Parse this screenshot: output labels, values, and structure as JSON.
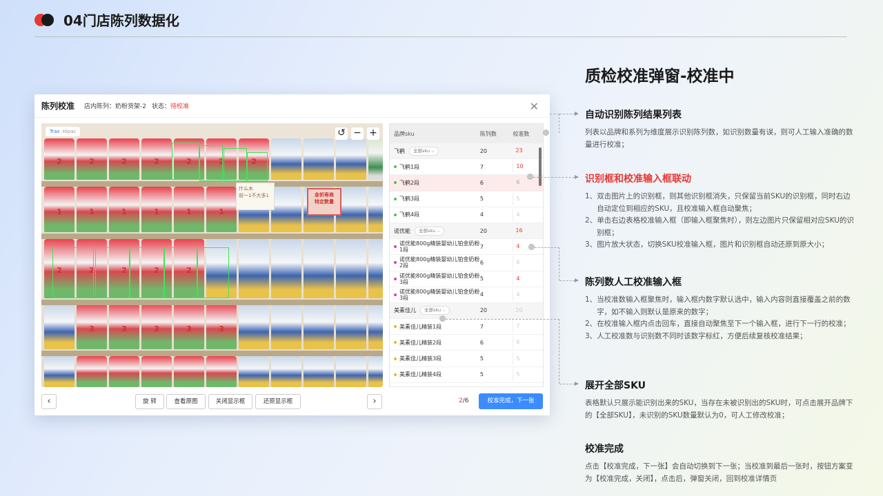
{
  "header": {
    "title": "04门店陈列数据化"
  },
  "dialog": {
    "title": "陈列校准",
    "shelf_label": "店内陈列：",
    "shelf_value": "奶粉货架-2",
    "status_label": "状态：",
    "status_value": "待校准",
    "close": "✕",
    "photo_tabs": [
      "Trax",
      "Hipac"
    ],
    "tools": {
      "rotate": "↺",
      "zoom_out": "−",
      "zoom_in": "+"
    },
    "photo_notes": {
      "card": "什么木\n前一1不大多1",
      "sign": "金祈寿商\n特定数量"
    },
    "table": {
      "headers": [
        "品牌sku",
        "陈列数",
        "校准数"
      ],
      "all_sku": "全部sku ⌵",
      "rows": [
        {
          "type": "brand",
          "sku": "飞鹤",
          "count": "20",
          "cal": "23",
          "style": "red"
        },
        {
          "type": "sku",
          "sku": "飞鹤1段",
          "count": "7",
          "cal": "10",
          "style": "red",
          "dot": "#3cc85a"
        },
        {
          "type": "sku",
          "sku": "飞鹤2段",
          "count": "6",
          "cal": "6",
          "style": "focus",
          "dot": "#3cc85a",
          "hl": true
        },
        {
          "type": "sku",
          "sku": "飞鹤3段",
          "count": "5",
          "cal": "5",
          "style": "grey",
          "dot": "#3cc85a"
        },
        {
          "type": "sku",
          "sku": "飞鹤4段",
          "count": "4",
          "cal": "4",
          "style": "grey",
          "dot": "#3cc85a"
        },
        {
          "type": "brand",
          "sku": "诺优能",
          "count": "20",
          "cal": "16",
          "style": "red"
        },
        {
          "type": "sku",
          "sku": "诺优能800g精装婴幼儿铂金奶粉1段",
          "count": "7",
          "cal": "4",
          "style": "red",
          "dot": "#d63cc8"
        },
        {
          "type": "sku",
          "sku": "诺优能800g精装婴幼儿铂金奶粉2段",
          "count": "6",
          "cal": "6",
          "style": "grey",
          "dot": "#d63cc8"
        },
        {
          "type": "sku",
          "sku": "诺优能800g精装婴幼儿铂金奶粉3段",
          "count": "5",
          "cal": "4",
          "style": "red",
          "dot": "#d63cc8"
        },
        {
          "type": "sku",
          "sku": "诺优能800g精装婴幼儿铂金奶粉3段",
          "count": "4",
          "cal": "4",
          "style": "grey",
          "dot": "#d63cc8"
        },
        {
          "type": "brand",
          "sku": "美素佳儿",
          "count": "20",
          "cal": "20",
          "style": "grey"
        },
        {
          "type": "sku",
          "sku": "美素佳儿精装1段",
          "count": "7",
          "cal": "7",
          "style": "grey",
          "dot": "#f0b429"
        },
        {
          "type": "sku",
          "sku": "美素佳儿精装2段",
          "count": "6",
          "cal": "6",
          "style": "grey",
          "dot": "#f0b429"
        },
        {
          "type": "sku",
          "sku": "美素佳儿精装3段",
          "count": "5",
          "cal": "5",
          "style": "grey",
          "dot": "#f0b429"
        },
        {
          "type": "sku",
          "sku": "美素佳儿精装4段",
          "count": "5",
          "cal": "5",
          "style": "grey",
          "dot": "#f0b429"
        }
      ]
    },
    "footer": {
      "prev": "‹",
      "next": "›",
      "buttons": [
        "旋 转",
        "查看原图",
        "关闭显示框",
        "还原显示框"
      ],
      "page_current": "2",
      "page_total": "/6",
      "primary": "校准完成，下一张"
    }
  },
  "panel": {
    "title": "质检校准弹窗-校准中",
    "sections": [
      {
        "title": "自动识别陈列结果列表",
        "red": false,
        "lines": [
          {
            "n": "",
            "t": "列表以品牌和系列为维度展示识别陈列数，如识别数量有误，则可人工输入准确的数量进行校准；"
          }
        ]
      },
      {
        "title": "识别框和校准输入框联动",
        "red": true,
        "lines": [
          {
            "n": "1、",
            "t": "双击图片上的识别框，则其他识别框消失，只保留当前SKU的识别框，同时右边自动定位到相应的SKU，且校准输入框自动聚焦；"
          },
          {
            "n": "2、",
            "t": "单击右边表格校准输入框（即输入框聚焦时），则左边图片只保留相对应SKU的识别框；"
          },
          {
            "n": "3、",
            "t": "图片放大状态，切换SKU校准输入框，图片和识别框自动还原到原大小；"
          }
        ]
      },
      {
        "title": "陈列数人工校准输入框",
        "red": false,
        "lines": [
          {
            "n": "1、",
            "t": "当校准数输入框聚焦时，输入框内数字默认选中，输入内容则直接覆盖之前的数字，如不输入则默认是原来的数字；"
          },
          {
            "n": "2、",
            "t": "在校准输入框内点击回车，直接自动聚焦至下一个输入框，进行下一行的校准；"
          },
          {
            "n": "3、",
            "t": "人工校准数与识别数不同时该数字标红，方便后续复核校准结果；"
          }
        ]
      },
      {
        "title": "展开全部SKU",
        "red": false,
        "lines": [
          {
            "n": "",
            "t": "表格默认只展示能识别出来的SKU，当存在未被识别出的SKU时，可点击展开品牌下的【全部SKU】，未识别的SKU数量默认为0，可人工修改校准；"
          }
        ]
      },
      {
        "title": "校准完成",
        "red": false,
        "lines": [
          {
            "n": "",
            "t": "点击【校准完成，下一张】会自动切换到下一张；当校准到最后一张时，按钮方案变为【校准完成，关闭】，点击后，弹窗关闭，回到校准详情页"
          }
        ]
      }
    ]
  },
  "colors": {
    "accent": "#3b8cff",
    "alert": "#e53935",
    "detect_box": "#42e35b"
  }
}
